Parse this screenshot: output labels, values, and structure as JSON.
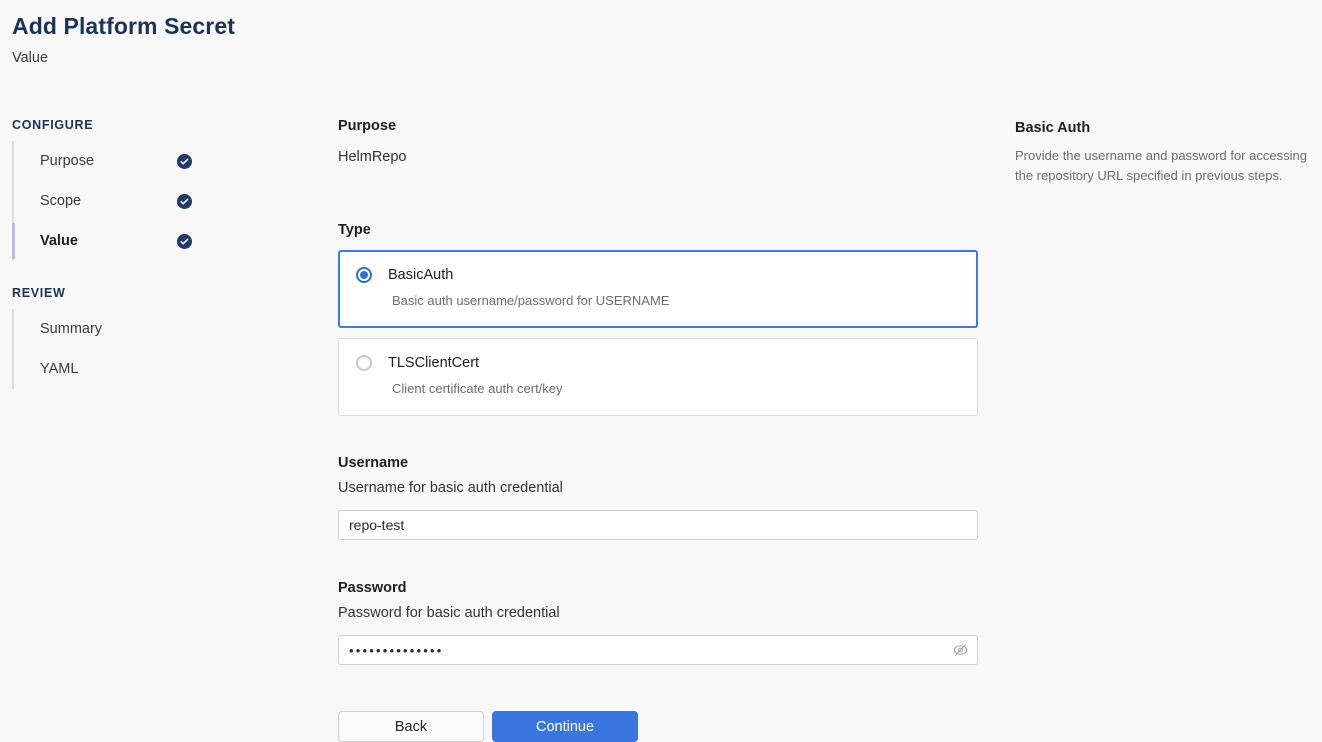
{
  "header": {
    "title": "Add Platform Secret",
    "subtitle": "Value"
  },
  "wizard": {
    "groups": [
      {
        "title": "CONFIGURE",
        "steps": [
          {
            "label": "Purpose",
            "complete": true,
            "active": false
          },
          {
            "label": "Scope",
            "complete": true,
            "active": false
          },
          {
            "label": "Value",
            "complete": true,
            "active": true
          }
        ]
      },
      {
        "title": "REVIEW",
        "steps": [
          {
            "label": "Summary",
            "complete": false,
            "active": false
          },
          {
            "label": "YAML",
            "complete": false,
            "active": false
          }
        ]
      }
    ]
  },
  "form": {
    "purpose": {
      "label": "Purpose",
      "value": "HelmRepo"
    },
    "type": {
      "label": "Type",
      "options": [
        {
          "label": "BasicAuth",
          "description": "Basic auth username/password for USERNAME",
          "selected": true
        },
        {
          "label": "TLSClientCert",
          "description": "Client certificate auth cert/key",
          "selected": false
        }
      ]
    },
    "username": {
      "label": "Username",
      "help": "Username for basic auth credential",
      "value": "repo-test",
      "placeholder": ""
    },
    "password": {
      "label": "Password",
      "help": "Password for basic auth credential",
      "value": "••••••••••••••",
      "placeholder": "",
      "toggle_icon": "eye-off-icon"
    },
    "buttons": {
      "back": "Back",
      "continue": "Continue"
    }
  },
  "help": {
    "title": "Basic Auth",
    "body": "Provide the username and password for accessing the repository URL specified in previous steps."
  },
  "colors": {
    "title": "#1b3358",
    "accent_blue": "#3b76e0",
    "radio_blue": "#2f6fd0",
    "check_navy": "#1f3a68",
    "active_rail": "#b7bcf0",
    "page_bg": "#f8f8f8"
  }
}
